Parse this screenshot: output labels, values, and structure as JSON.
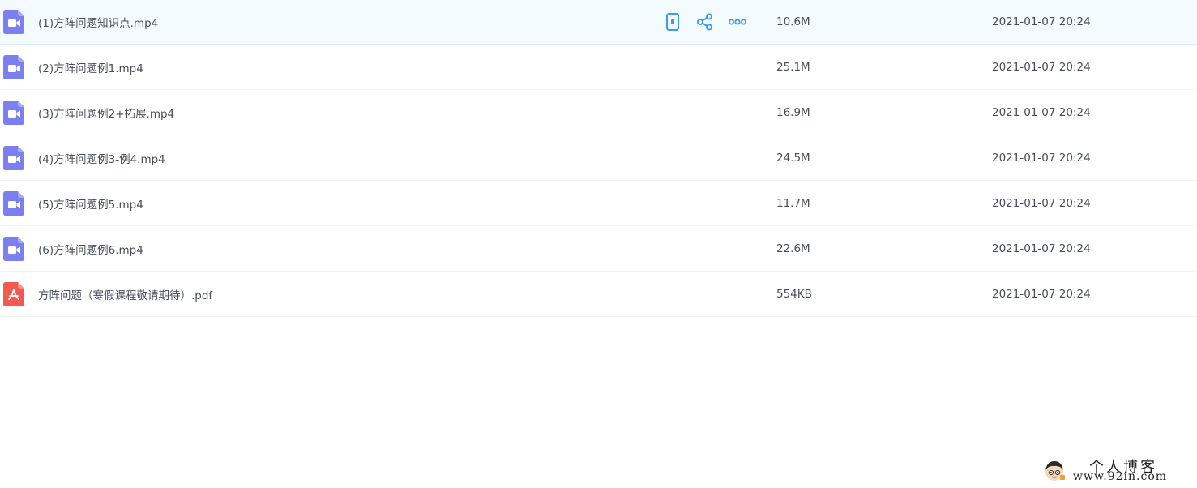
{
  "colors": {
    "video_icon": "#7b7ff0",
    "pdf_icon": "#f25a4f",
    "action_icon": "#3b9de3",
    "hover_row": "#f4fbff"
  },
  "row_actions": {
    "icons": [
      "phone-icon",
      "share-icon",
      "more-icon"
    ]
  },
  "files": [
    {
      "name": "(1)方阵问题知识点.mp4",
      "size": "10.6M",
      "date": "2021-01-07 20:24",
      "type": "video"
    },
    {
      "name": "(2)方阵问题例1.mp4",
      "size": "25.1M",
      "date": "2021-01-07 20:24",
      "type": "video"
    },
    {
      "name": "(3)方阵问题例2+拓展.mp4",
      "size": "16.9M",
      "date": "2021-01-07 20:24",
      "type": "video"
    },
    {
      "name": "(4)方阵问题例3-例4.mp4",
      "size": "24.5M",
      "date": "2021-01-07 20:24",
      "type": "video"
    },
    {
      "name": "(5)方阵问题例5.mp4",
      "size": "11.7M",
      "date": "2021-01-07 20:24",
      "type": "video"
    },
    {
      "name": "(6)方阵问题例6.mp4",
      "size": "22.6M",
      "date": "2021-01-07 20:24",
      "type": "video"
    },
    {
      "name": "方阵问题（寒假课程敬请期待）.pdf",
      "size": "554KB",
      "date": "2021-01-07 20:24",
      "type": "pdf"
    }
  ],
  "watermark": {
    "title": "个人博客",
    "url": "www.92in.com"
  }
}
